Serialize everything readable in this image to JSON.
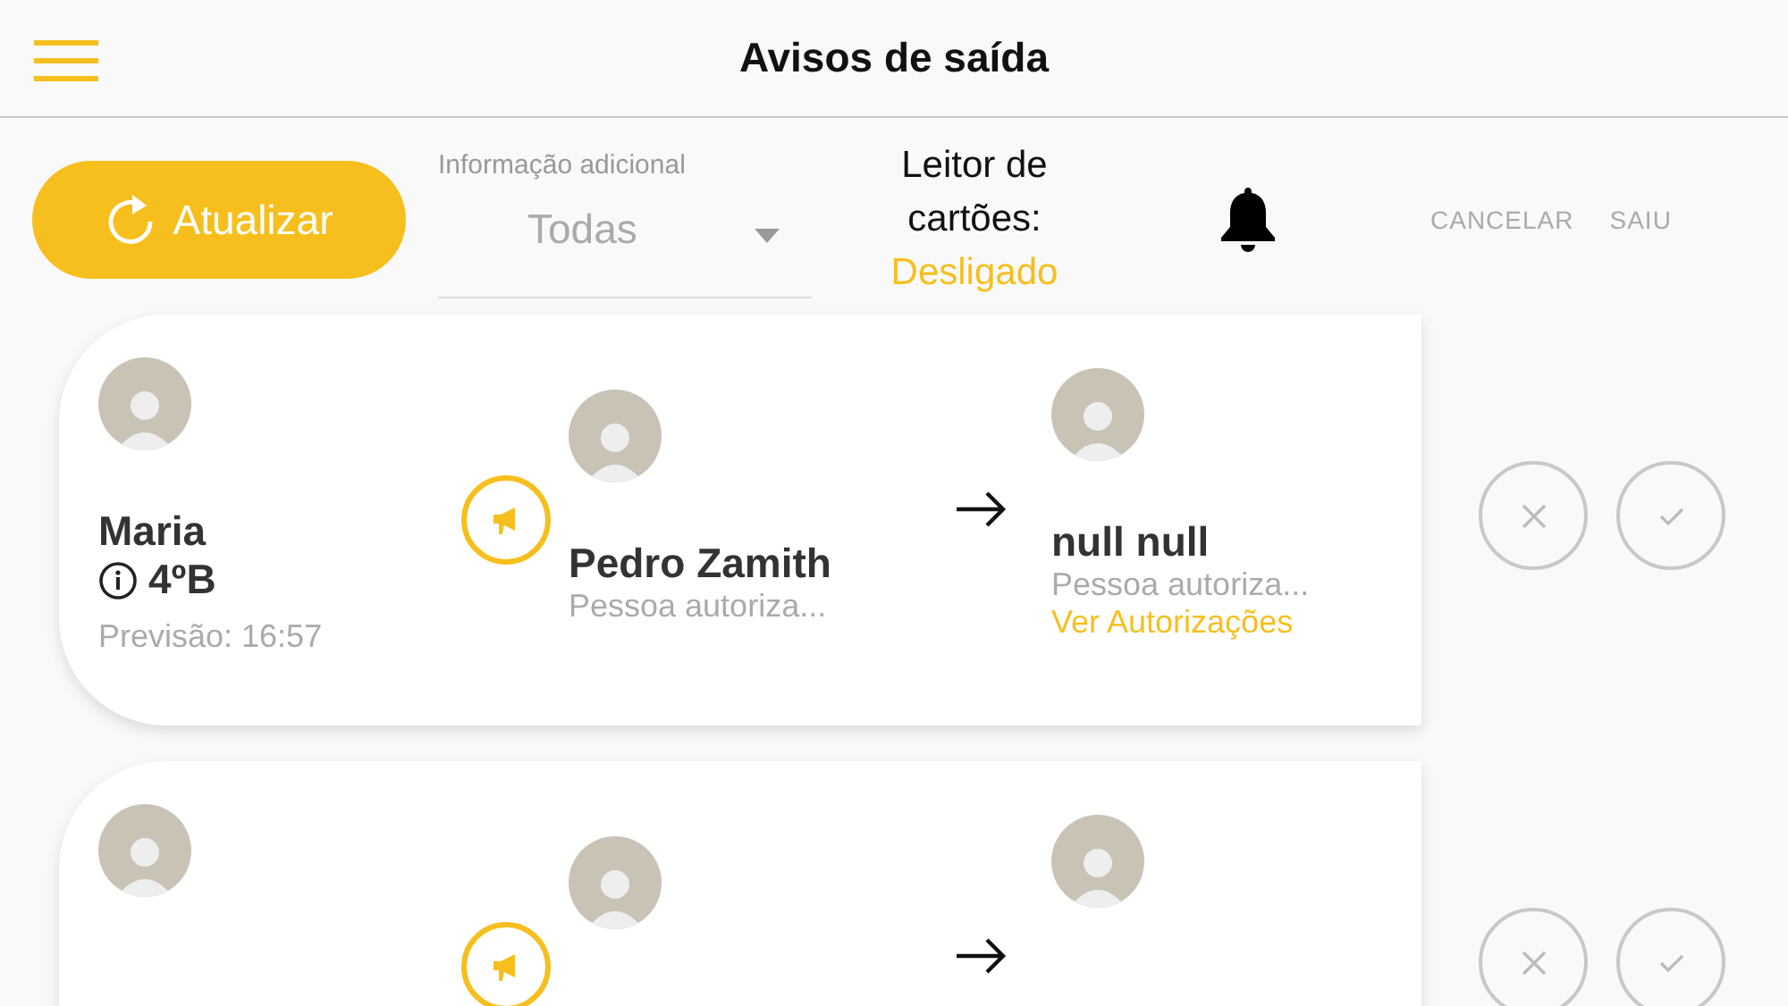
{
  "header": {
    "title": "Avisos de saída"
  },
  "toolbar": {
    "refresh_button": "Atualizar",
    "filter": {
      "label": "Informação adicional",
      "value": "Todas"
    },
    "card_reader": {
      "label": "Leitor de cartões:",
      "status": "Desligado"
    },
    "actions": [
      "CANCELAR",
      "SAIU"
    ]
  },
  "notices": [
    {
      "kind": "full",
      "student": {
        "name": "Maria",
        "class": "4ºB",
        "forecast": "Previsão: 16:57"
      },
      "authorizer": {
        "name": "Pedro Zamith",
        "role": "Pessoa autoriza..."
      },
      "recipient": {
        "name": "null null",
        "role": "Pessoa autoriza...",
        "link": "Ver Autorizações"
      }
    },
    {
      "kind": "cut_off"
    }
  ]
}
